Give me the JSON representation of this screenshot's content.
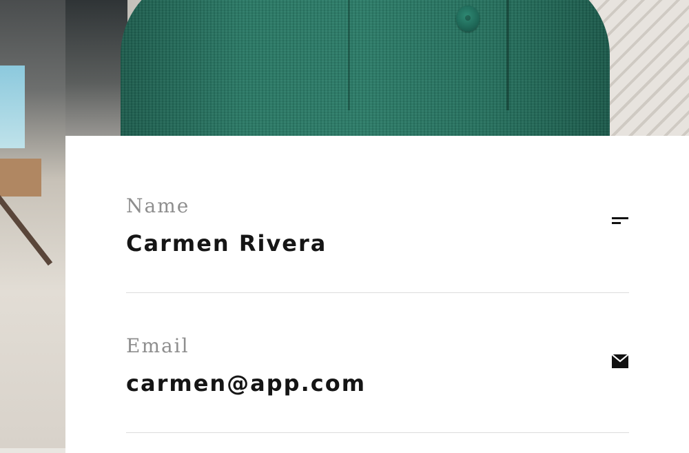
{
  "form": {
    "fields": [
      {
        "label": "Name",
        "value": "Carmen Rivera",
        "icon": "text-lines-icon"
      },
      {
        "label": "Email",
        "value": "carmen@app.com",
        "icon": "envelope-icon"
      }
    ]
  },
  "colors": {
    "label": "#8e8e8e",
    "value": "#151515",
    "divider": "#dcdcdc",
    "card": "#ffffff",
    "coat": "#2a7a66"
  }
}
